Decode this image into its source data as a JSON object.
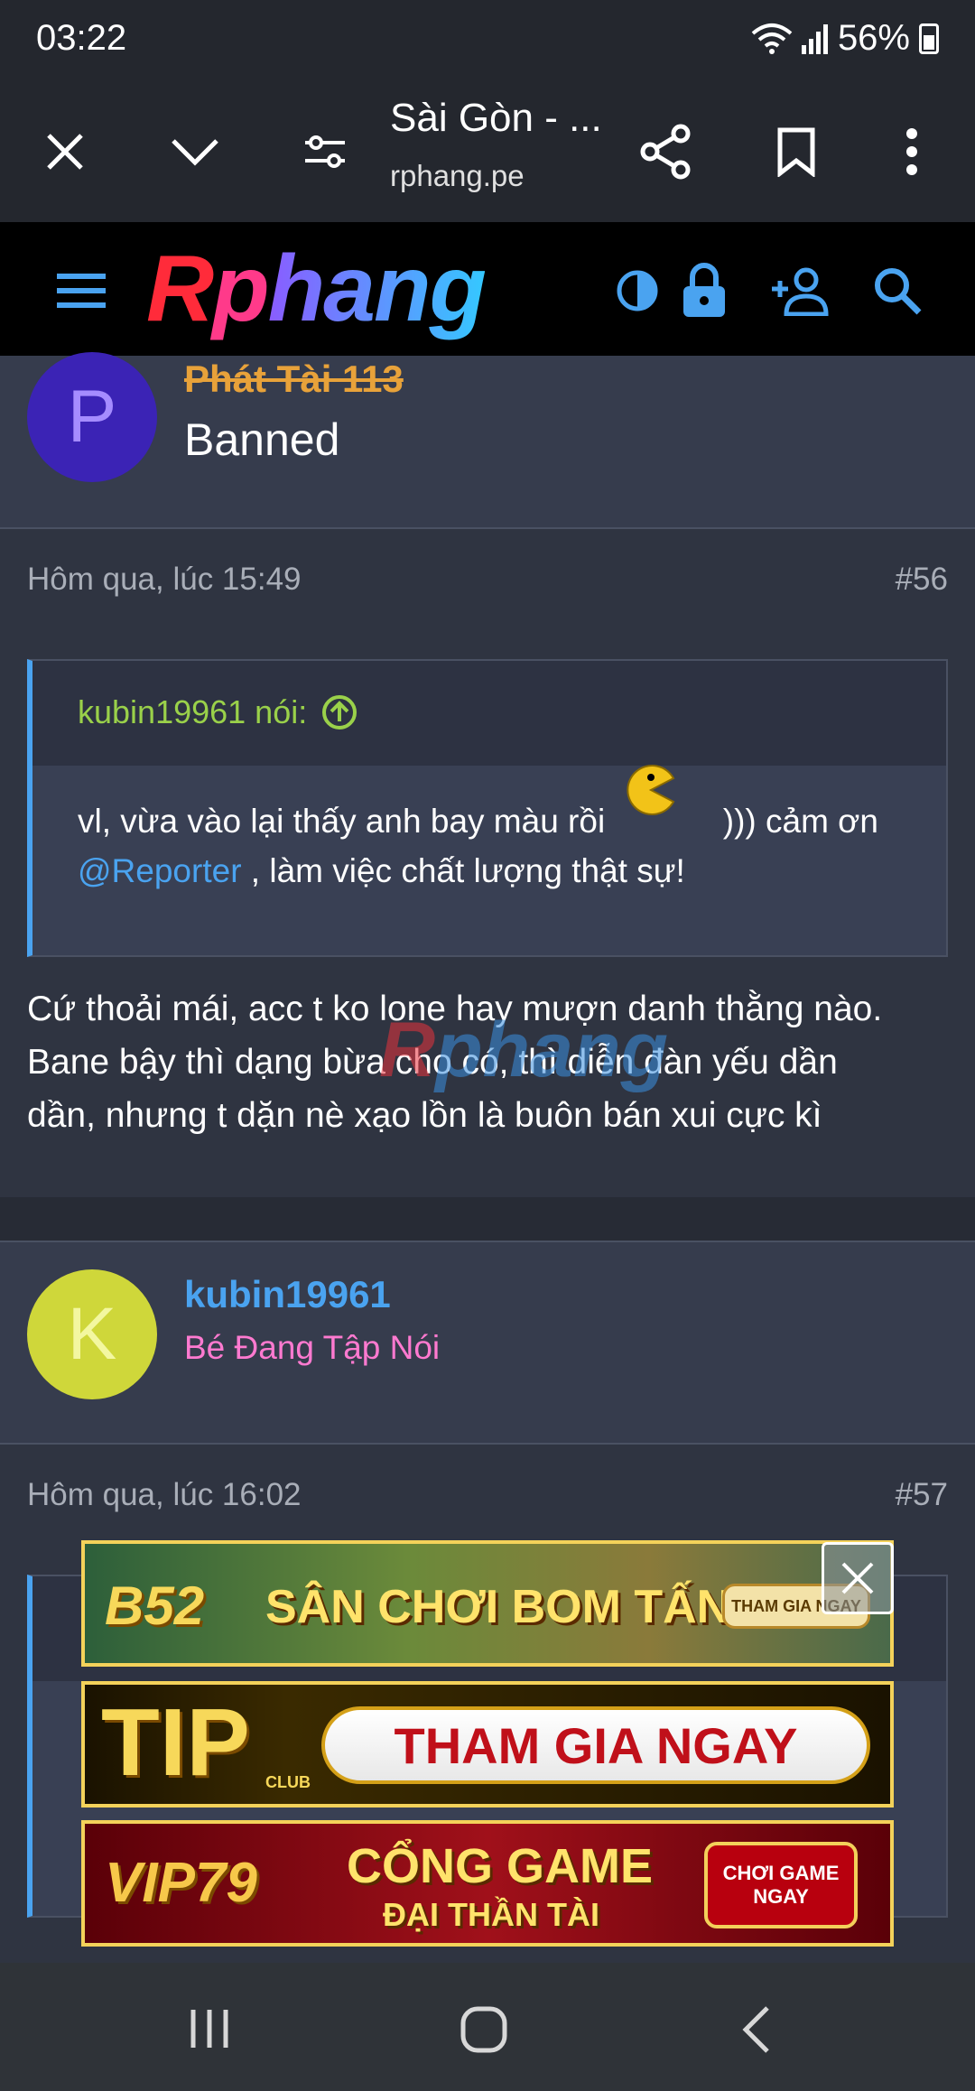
{
  "status_bar": {
    "time": "03:22",
    "battery": "56%"
  },
  "browser": {
    "page_title": "Sài Gòn - ...",
    "url": "rphang.pe"
  },
  "site": {
    "logo": "Rphang"
  },
  "posts": [
    {
      "user": {
        "initial": "P",
        "name": "Phát Tài 113",
        "title": "Banned"
      }
    },
    {
      "timestamp": "Hôm qua, lúc 15:49",
      "number": "#56",
      "quote": {
        "author": "kubin19961 nói:",
        "text_before": "vl, vừa vào lại thấy anh bay màu rồi",
        "text_after": "))) cảm ơn",
        "mention": "@Reporter",
        "text_end": ", làm việc chất lượng thật sự!"
      },
      "body_lines": [
        "Cứ thoải mái, acc t ko lone hay mượn danh thằng nào.",
        "Bane bậy thì dạng bừa cho có, thì diễn đàn yếu dần",
        "dần, nhưng t dặn nè xạo lồn là buôn bán xui cực kì"
      ]
    },
    {
      "user": {
        "initial": "K",
        "name": "kubin19961",
        "title": "Bé Đang Tập Nói"
      },
      "timestamp": "Hôm qua, lúc 16:02",
      "number": "#57"
    }
  ],
  "ads": [
    {
      "brand": "B52",
      "headline": "SÂN CHƠI BOM TẤN",
      "cta": "THAM GIA NGAY"
    },
    {
      "brand": "TIP",
      "sub": "CLUB",
      "headline": "THAM GIA NGAY"
    },
    {
      "brand": "VIP79",
      "headline": "CỔNG GAME",
      "subheadline": "ĐẠI THẦN TÀI",
      "cta": "CHƠI GAME NGAY"
    }
  ],
  "colors": {
    "accent_blue": "#4aa3f0",
    "banned_orange": "#e8a23a",
    "quote_green": "#9ad14a",
    "user_title_pink": "#ff7ad0"
  }
}
